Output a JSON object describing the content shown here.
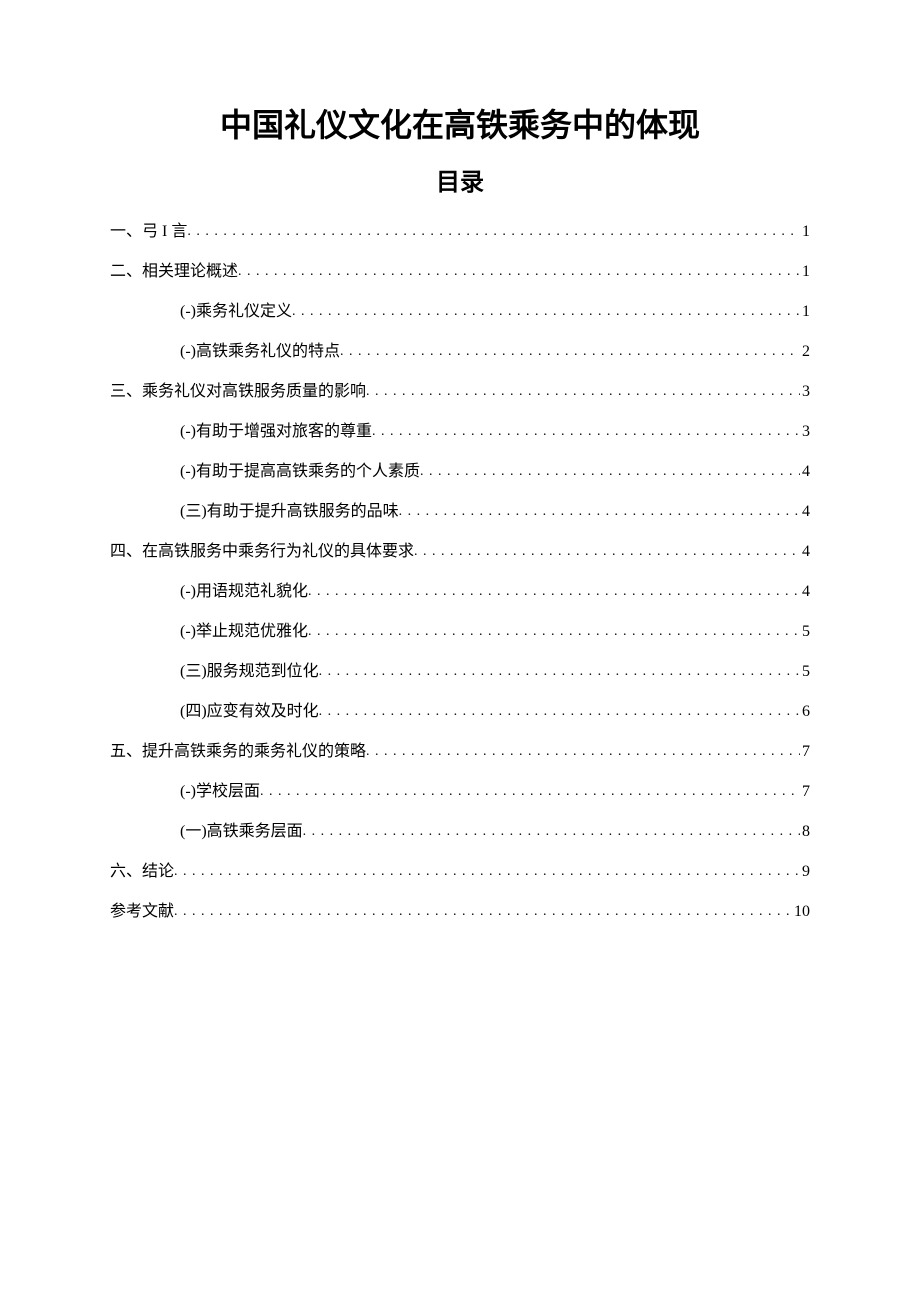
{
  "title": "中国礼仪文化在高铁乘务中的体现",
  "subtitle": "目录",
  "toc": [
    {
      "level": 1,
      "label": "一、弓 I 言",
      "page": "1"
    },
    {
      "level": 1,
      "label": "二、相关理论概述",
      "page": "1"
    },
    {
      "level": 2,
      "label": "(-)乘务礼仪定义",
      "page": "1"
    },
    {
      "level": 2,
      "label": "(-)高铁乘务礼仪的特点",
      "page": "2"
    },
    {
      "level": 1,
      "label": "三、乘务礼仪对高铁服务质量的影响",
      "page": "3"
    },
    {
      "level": 2,
      "label": "(-)有助于增强对旅客的尊重",
      "page": "3"
    },
    {
      "level": 2,
      "label": "(-)有助于提高高铁乘务的个人素质",
      "page": "4"
    },
    {
      "level": 2,
      "label": "(三)有助于提升高铁服务的品味",
      "page": "4"
    },
    {
      "level": 1,
      "label": "四、在高铁服务中乘务行为礼仪的具体要求",
      "page": "4"
    },
    {
      "level": 2,
      "label": "(-)用语规范礼貌化",
      "page": "4"
    },
    {
      "level": 2,
      "label": "(-)举止规范优雅化",
      "page": "5"
    },
    {
      "level": 2,
      "label": "(三)服务规范到位化",
      "page": "5"
    },
    {
      "level": 2,
      "label": "(四)应变有效及时化",
      "page": "6"
    },
    {
      "level": 1,
      "label": "五、提升高铁乘务的乘务礼仪的策略",
      "page": "7"
    },
    {
      "level": 2,
      "label": "(-)学校层面",
      "page": "7"
    },
    {
      "level": 2,
      "label": "(一)高铁乘务层面",
      "page": "8"
    },
    {
      "level": 1,
      "label": "六、结论",
      "page": "9"
    },
    {
      "level": 1,
      "label": "参考文献",
      "page": "10"
    }
  ]
}
